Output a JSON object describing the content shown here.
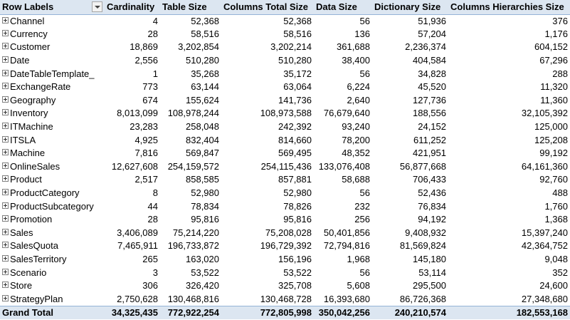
{
  "header": {
    "row_labels": "Row Labels",
    "columns": [
      "Cardinality",
      "Table Size",
      "Columns Total Size",
      "Data Size",
      "Dictionary Size",
      "Columns Hierarchies Size"
    ]
  },
  "rows": [
    {
      "label": "Channel",
      "values": [
        "4",
        "52,368",
        "52,368",
        "56",
        "51,936",
        "376"
      ]
    },
    {
      "label": "Currency",
      "values": [
        "28",
        "58,516",
        "58,516",
        "136",
        "57,204",
        "1,176"
      ]
    },
    {
      "label": "Customer",
      "values": [
        "18,869",
        "3,202,854",
        "3,202,214",
        "361,688",
        "2,236,374",
        "604,152"
      ]
    },
    {
      "label": "Date",
      "values": [
        "2,556",
        "510,280",
        "510,280",
        "38,400",
        "404,584",
        "67,296"
      ]
    },
    {
      "label": "DateTableTemplate_",
      "values": [
        "1",
        "35,268",
        "35,172",
        "56",
        "34,828",
        "288"
      ]
    },
    {
      "label": "ExchangeRate",
      "values": [
        "773",
        "63,144",
        "63,064",
        "6,224",
        "45,520",
        "11,320"
      ]
    },
    {
      "label": "Geography",
      "values": [
        "674",
        "155,624",
        "141,736",
        "2,640",
        "127,736",
        "11,360"
      ]
    },
    {
      "label": "Inventory",
      "values": [
        "8,013,099",
        "108,978,244",
        "108,973,588",
        "76,679,640",
        "188,556",
        "32,105,392"
      ]
    },
    {
      "label": "ITMachine",
      "values": [
        "23,283",
        "258,048",
        "242,392",
        "93,240",
        "24,152",
        "125,000"
      ]
    },
    {
      "label": "ITSLA",
      "values": [
        "4,925",
        "832,404",
        "814,660",
        "78,200",
        "611,252",
        "125,208"
      ]
    },
    {
      "label": "Machine",
      "values": [
        "7,816",
        "569,847",
        "569,495",
        "48,352",
        "421,951",
        "99,192"
      ]
    },
    {
      "label": "OnlineSales",
      "values": [
        "12,627,608",
        "254,159,572",
        "254,115,436",
        "133,076,408",
        "56,877,668",
        "64,161,360"
      ]
    },
    {
      "label": "Product",
      "values": [
        "2,517",
        "858,585",
        "857,881",
        "58,688",
        "706,433",
        "92,760"
      ]
    },
    {
      "label": "ProductCategory",
      "values": [
        "8",
        "52,980",
        "52,980",
        "56",
        "52,436",
        "488"
      ]
    },
    {
      "label": "ProductSubcategory",
      "values": [
        "44",
        "78,834",
        "78,826",
        "232",
        "76,834",
        "1,760"
      ]
    },
    {
      "label": "Promotion",
      "values": [
        "28",
        "95,816",
        "95,816",
        "256",
        "94,192",
        "1,368"
      ]
    },
    {
      "label": "Sales",
      "values": [
        "3,406,089",
        "75,214,220",
        "75,208,028",
        "50,401,856",
        "9,408,932",
        "15,397,240"
      ]
    },
    {
      "label": "SalesQuota",
      "values": [
        "7,465,911",
        "196,733,872",
        "196,729,392",
        "72,794,816",
        "81,569,824",
        "42,364,752"
      ]
    },
    {
      "label": "SalesTerritory",
      "values": [
        "265",
        "163,020",
        "156,196",
        "1,968",
        "145,180",
        "9,048"
      ]
    },
    {
      "label": "Scenario",
      "values": [
        "3",
        "53,522",
        "53,522",
        "56",
        "53,114",
        "352"
      ]
    },
    {
      "label": "Store",
      "values": [
        "306",
        "326,420",
        "325,708",
        "5,608",
        "295,500",
        "24,600"
      ]
    },
    {
      "label": "StrategyPlan",
      "values": [
        "2,750,628",
        "130,468,816",
        "130,468,728",
        "16,393,680",
        "86,726,368",
        "27,348,680"
      ]
    }
  ],
  "grand_total": {
    "label": "Grand Total",
    "values": [
      "34,325,435",
      "772,922,254",
      "772,805,998",
      "350,042,256",
      "240,210,574",
      "182,553,168"
    ]
  },
  "icons": {
    "expand": "expand-plus-icon",
    "filter": "filter-dropdown-icon"
  },
  "colors": {
    "header_bg": "#dce6f1",
    "header_border": "#95b3d7"
  }
}
